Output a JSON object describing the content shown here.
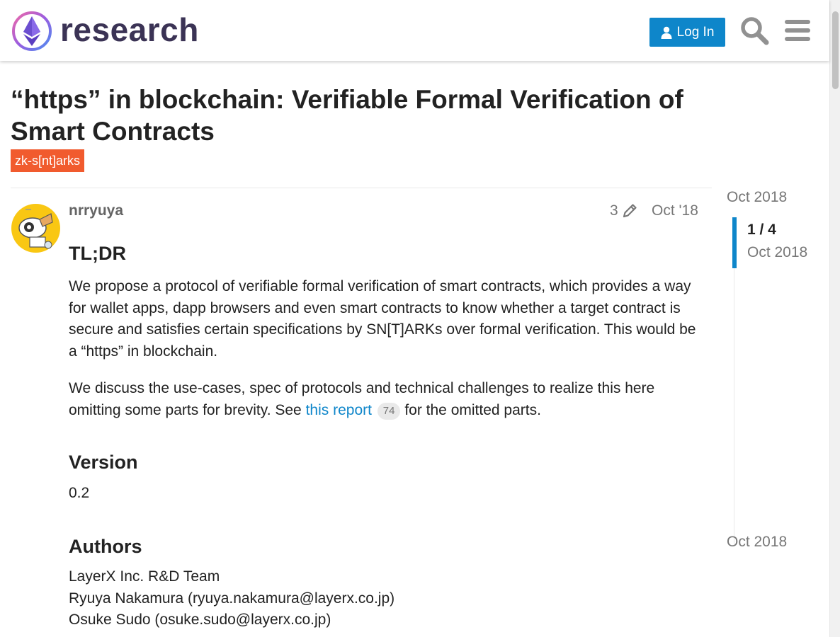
{
  "header": {
    "site_name": "research",
    "login_label": "Log In",
    "colors": {
      "login_bg": "#0e86ca",
      "logo_text": "#3b3355"
    }
  },
  "topic": {
    "title": "“https” in blockchain: Verifiable Formal Verification of Smart Contracts",
    "tag": "zk-s[nt]arks",
    "tag_color": "#f15b2e"
  },
  "post": {
    "username": "nrryuya",
    "edit_count": "3",
    "date": "Oct '18",
    "tldr_heading": "TL;DR",
    "p1": "We propose a protocol of verifiable formal verification of smart contracts, which provides a way for wallet apps, dapp browsers and even smart contracts to know whether a target contract is secure and satisfies certain specifications by SN[T]ARKs over formal verification. This would be a “https” in blockchain.",
    "p2_before": "We discuss the use-cases, spec of protocols and technical challenges to realize this here omitting some parts for brevity. See ",
    "p2_link": "this report",
    "p2_clicks": "74",
    "p2_after": " for the omitted parts.",
    "version_heading": "Version",
    "version_value": "0.2",
    "authors_heading": "Authors",
    "authors": [
      "LayerX Inc. R&D Team",
      "Ryuya Nakamura (ryuya.nakamura@layerx.co.jp)",
      "Osuke Sudo (osuke.sudo@layerx.co.jp)"
    ]
  },
  "timeline": {
    "start_date": "Oct 2018",
    "position": "1 / 4",
    "position_date": "Oct 2018",
    "end_date": "Oct 2018"
  },
  "icons": [
    "logo-icon",
    "user-icon",
    "search-icon",
    "menu-icon",
    "pencil-icon",
    "avatar"
  ]
}
